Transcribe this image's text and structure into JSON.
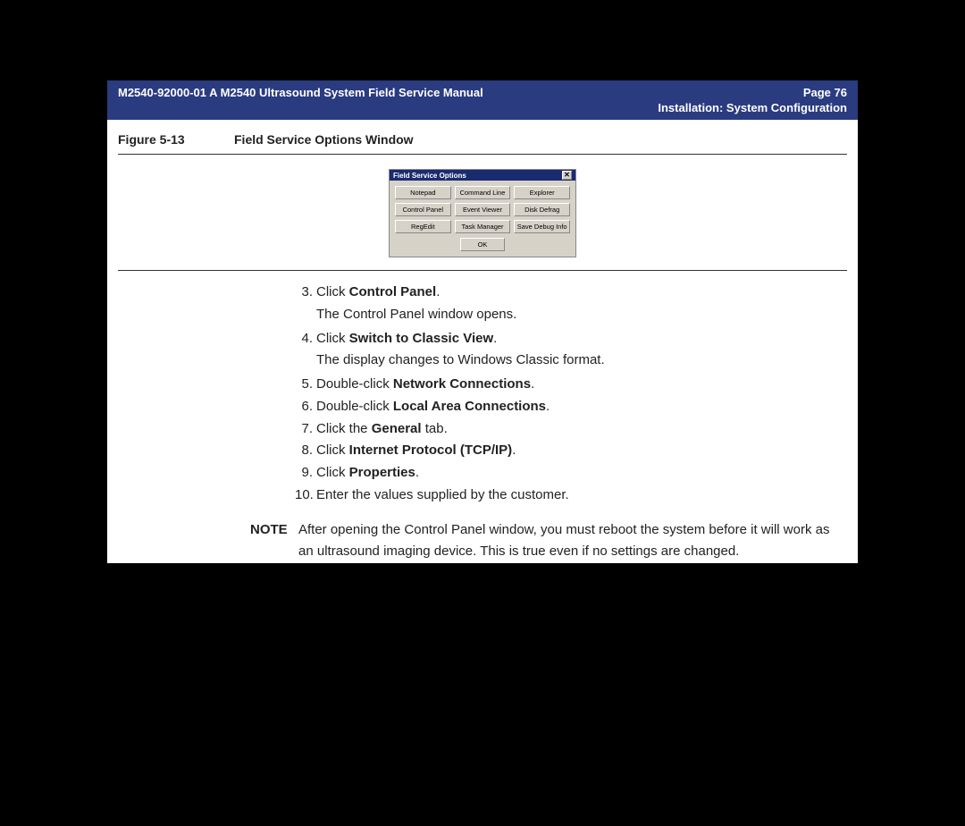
{
  "header": {
    "doc_id": "M2540-92000-01 A M2540 Ultrasound System Field Service Manual",
    "page_label": "Page 76",
    "section": "Installation: System Configuration"
  },
  "figure": {
    "label": "Figure 5-13",
    "title": "Field Service Options Window"
  },
  "window": {
    "title": "Field Service Options",
    "buttons": {
      "b1": "Notepad",
      "b2": "Command Line",
      "b3": "Explorer",
      "b4": "Control Panel",
      "b5": "Event Viewer",
      "b6": "Disk Defrag",
      "b7": "RegEdit",
      "b8": "Task Manager",
      "b9": "Save Debug Info"
    },
    "ok": "OK",
    "close": "✕"
  },
  "steps": {
    "s3": {
      "num": "3.",
      "pre": "Click ",
      "bold": "Control Panel",
      "post": ".",
      "sub": "The Control Panel window opens."
    },
    "s4": {
      "num": "4.",
      "pre": "Click ",
      "bold": "Switch to Classic View",
      "post": ".",
      "sub": "The display changes to Windows Classic format."
    },
    "s5": {
      "num": "5.",
      "pre": "Double-click ",
      "bold": "Network Connections",
      "post": "."
    },
    "s6": {
      "num": "6.",
      "pre": "Double-click ",
      "bold": "Local Area Connections",
      "post": "."
    },
    "s7": {
      "num": "7.",
      "pre": "Click the ",
      "bold": "General",
      "post": " tab."
    },
    "s8": {
      "num": "8.",
      "pre": "Click ",
      "bold": "Internet Protocol (TCP/IP)",
      "post": "."
    },
    "s9": {
      "num": "9.",
      "pre": "Click ",
      "bold": "Properties",
      "post": "."
    },
    "s10": {
      "num": "10.",
      "text": "Enter the values supplied by the customer."
    }
  },
  "note": {
    "label": "NOTE",
    "text": "After opening the Control Panel window, you must reboot the system before it will work as an ultrasound imaging device. This is true even if no settings are changed."
  }
}
